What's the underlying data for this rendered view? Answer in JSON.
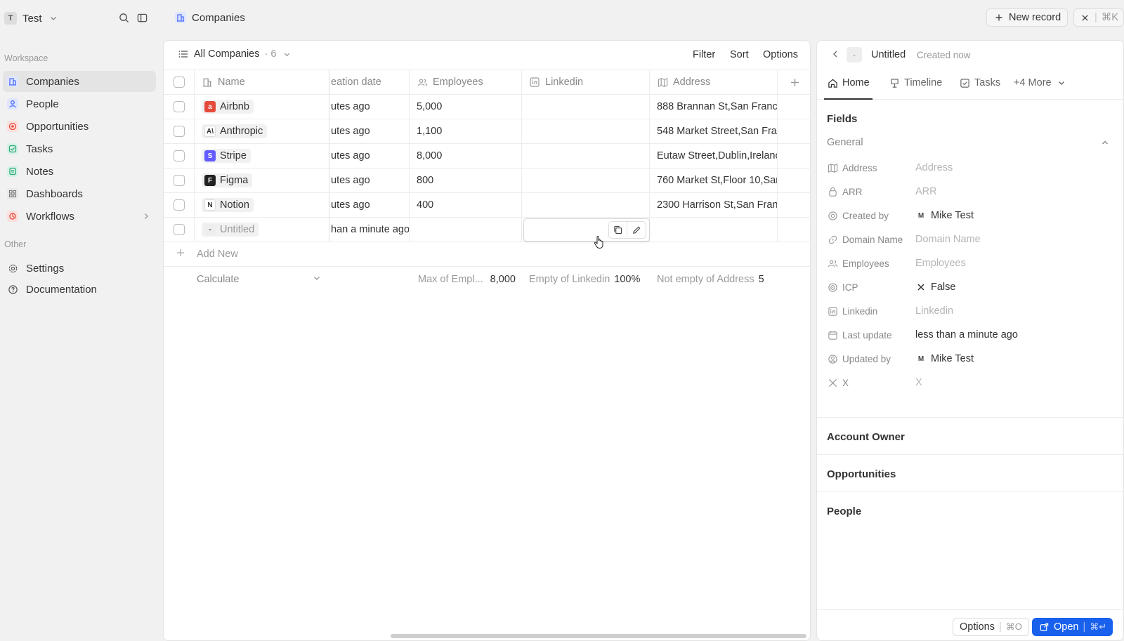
{
  "workspace": {
    "initial": "T",
    "name": "Test"
  },
  "sidebar": {
    "workspace_label": "Workspace",
    "items": [
      {
        "label": "Companies",
        "icon": "building-icon",
        "color": "#4a6cf7"
      },
      {
        "label": "People",
        "icon": "user-icon",
        "color": "#4a6cf7"
      },
      {
        "label": "Opportunities",
        "icon": "target-icon",
        "color": "#e5493a"
      },
      {
        "label": "Tasks",
        "icon": "checkbox-icon",
        "color": "#2aa876"
      },
      {
        "label": "Notes",
        "icon": "note-icon",
        "color": "#2aa876"
      },
      {
        "label": "Dashboards",
        "icon": "grid-icon",
        "color": "#777777"
      },
      {
        "label": "Workflows",
        "icon": "workflow-icon",
        "color": "#e5493a"
      }
    ],
    "other_label": "Other",
    "other_items": [
      {
        "label": "Settings",
        "icon": "gear-icon"
      },
      {
        "label": "Documentation",
        "icon": "help-icon"
      }
    ]
  },
  "header": {
    "page_title": "Companies",
    "new_record": "New record",
    "close_shortcut": "⌘K"
  },
  "view": {
    "name": "All Companies",
    "count": "· 6",
    "filter": "Filter",
    "sort": "Sort",
    "options": "Options"
  },
  "table": {
    "columns": [
      "Name",
      "eation date",
      "Employees",
      "Linkedin",
      "Address"
    ],
    "rows": [
      {
        "name": "Airbnb",
        "created": "utes ago",
        "employees": "5,000",
        "linkedin": "",
        "address": "888 Brannan St,San Franci",
        "logo_color": "#e5493a",
        "logo_text": "a"
      },
      {
        "name": "Anthropic",
        "created": "utes ago",
        "employees": "1,100",
        "linkedin": "",
        "address": "548 Market Street,San Fra",
        "logo_color": "#ffffff",
        "logo_text": "A\\"
      },
      {
        "name": "Stripe",
        "created": "utes ago",
        "employees": "8,000",
        "linkedin": "",
        "address": "Eutaw Street,Dublin,Irelanc",
        "logo_color": "#635bff",
        "logo_text": "S"
      },
      {
        "name": "Figma",
        "created": "utes ago",
        "employees": "800",
        "linkedin": "",
        "address": "760 Market St,Floor 10,Sar",
        "logo_color": "#222222",
        "logo_text": "F"
      },
      {
        "name": "Notion",
        "created": "utes ago",
        "employees": "400",
        "linkedin": "",
        "address": "2300 Harrison St,San Fran",
        "logo_color": "#ffffff",
        "logo_text": "N"
      },
      {
        "name": "Untitled",
        "created": "han a minute ago",
        "employees": "",
        "linkedin": "",
        "address": "",
        "logo_color": "#eeeeee",
        "logo_text": "-"
      }
    ],
    "add_new": "Add New",
    "calculate": "Calculate",
    "agg_employees_label": "Max of Empl...",
    "agg_employees_value": "8,000",
    "agg_linkedin_label": "Empty of Linkedin",
    "agg_linkedin_value": "100%",
    "agg_address_label": "Not empty of Address",
    "agg_address_value": "5"
  },
  "detail": {
    "dash": "-",
    "title": "Untitled",
    "created": "Created now",
    "tabs": [
      "Home",
      "Timeline",
      "Tasks",
      "+4 More"
    ],
    "fields_heading": "Fields",
    "general_heading": "General",
    "fields": [
      {
        "label": "Address",
        "value": "Address",
        "empty": true,
        "icon": "map-icon"
      },
      {
        "label": "ARR",
        "value": "ARR",
        "empty": true,
        "icon": "money-icon"
      },
      {
        "label": "Created by",
        "value": "Mike Test",
        "empty": false,
        "icon": "creator-icon",
        "avatar": "M"
      },
      {
        "label": "Domain Name",
        "value": "Domain Name",
        "empty": true,
        "icon": "link-icon"
      },
      {
        "label": "Employees",
        "value": "Employees",
        "empty": true,
        "icon": "users-icon"
      },
      {
        "label": "ICP",
        "value": "False",
        "empty": false,
        "icon": "target-icon",
        "x_mark": true
      },
      {
        "label": "Linkedin",
        "value": "Linkedin",
        "empty": true,
        "icon": "linkedin-icon"
      },
      {
        "label": "Last update",
        "value": "less than a minute ago",
        "empty": false,
        "icon": "calendar-icon"
      },
      {
        "label": "Updated by",
        "value": "Mike Test",
        "empty": false,
        "icon": "user-circle-icon",
        "avatar": "M"
      },
      {
        "label": "X",
        "value": "X",
        "empty": true,
        "icon": "x-logo-icon"
      }
    ],
    "sections": [
      "Account Owner",
      "Opportunities",
      "People"
    ],
    "footer_options": "Options",
    "footer_options_shortcut": "⌘O",
    "footer_open": "Open",
    "footer_open_shortcut": "⌘↵"
  },
  "colors": {
    "accent": "#1961ed",
    "panel_bg": "#ffffff",
    "app_bg": "#f1f1f1"
  }
}
